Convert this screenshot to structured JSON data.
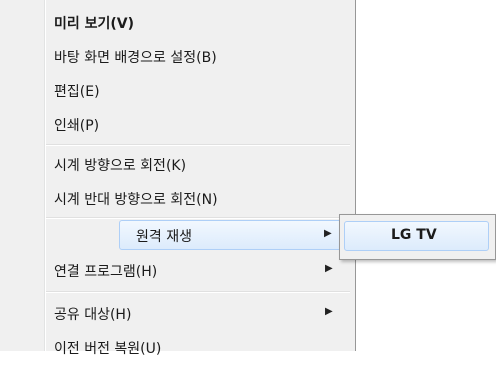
{
  "context_menu": {
    "items": [
      {
        "label": "미리 보기(V)"
      },
      {
        "label": "바탕 화면 배경으로 설정(B)"
      },
      {
        "label": "편집(E)"
      },
      {
        "label": "인쇄(P)"
      },
      {
        "label": "시계 방향으로 회전(K)"
      },
      {
        "label": "시계 반대 방향으로 회전(N)"
      },
      {
        "label": "원격 재생"
      },
      {
        "label": "연결 프로그램(H)"
      },
      {
        "label": "공유 대상(H)"
      },
      {
        "label": "이전 버전 복원(U)"
      }
    ],
    "submenu_arrow": "▶"
  },
  "submenu": {
    "items": [
      {
        "label": "LG TV"
      }
    ]
  }
}
